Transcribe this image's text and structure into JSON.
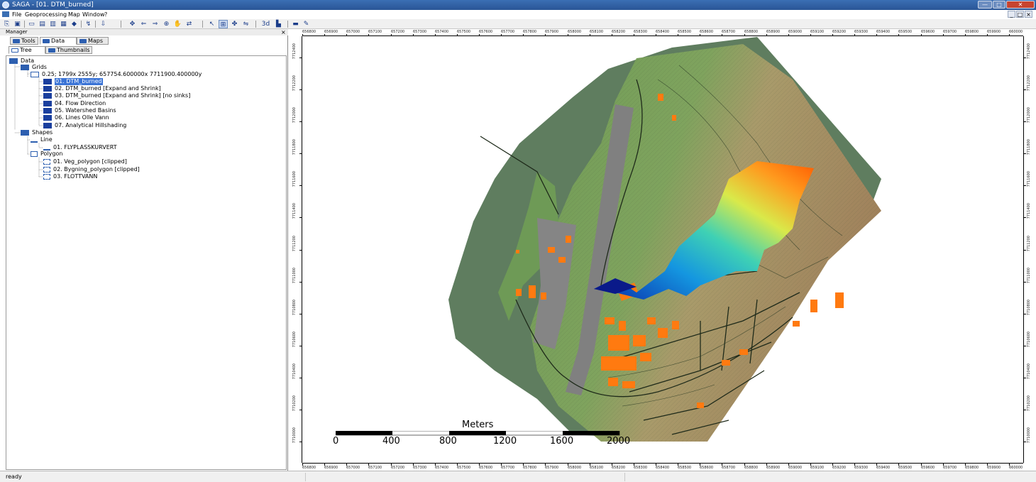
{
  "window": {
    "title": "SAGA - [01. DTM_burned]",
    "buttons": {
      "minimize": "—",
      "maximize": "□",
      "close": "✕"
    }
  },
  "menubar": {
    "items": [
      "File",
      "Geoprocessing",
      "Map",
      "Window",
      "?"
    ],
    "mdi_buttons": [
      "_",
      "□",
      "×"
    ]
  },
  "manager": {
    "title": "Manager",
    "close": "×",
    "tabs": [
      "Tools",
      "Data",
      "Maps"
    ],
    "active_tab": "Data",
    "subtabs": [
      "Tree",
      "Thumbnails"
    ],
    "active_subtab": "Tree"
  },
  "tree": {
    "root": "Data",
    "grids_label": "Grids",
    "grid_system": "0.25; 1799x 2555y; 657754.600000x 7711900.400000y",
    "grids": [
      "01. DTM_burned",
      "02. DTM_burned [Expand and Shrink]",
      "03. DTM_burned [Expand and Shrink] [no sinks]",
      "04. Flow Direction",
      "05. Watershed Basins",
      "06. Lines Olle Vann",
      "07. Analytical Hillshading"
    ],
    "selected_grid": "01. DTM_burned",
    "shapes_label": "Shapes",
    "line_label": "Line",
    "lines": [
      "01. FLYPLASSKURVERT"
    ],
    "polygon_label": "Polygon",
    "polygons": [
      "01. Veg_polygon [clipped]",
      "02. Bygning_polygon [clipped]",
      "03. FLOTTVANN"
    ]
  },
  "map": {
    "ruler_top": [
      "656800",
      "656900",
      "657000",
      "657100",
      "657200",
      "657300",
      "657400",
      "657500",
      "657600",
      "657700",
      "657800",
      "657900",
      "658000",
      "658100",
      "658200",
      "658300",
      "658400",
      "658500",
      "658600",
      "658700",
      "658800",
      "658900",
      "659000",
      "659100",
      "659200",
      "659300",
      "659400",
      "659500",
      "659600",
      "659700",
      "659800",
      "659900",
      "660000"
    ],
    "ruler_bottom": [
      "656800",
      "656900",
      "657000",
      "657100",
      "657200",
      "657300",
      "657400",
      "657500",
      "657600",
      "657700",
      "657800",
      "657900",
      "658000",
      "658100",
      "658200",
      "658300",
      "658400",
      "658500",
      "658600",
      "658700",
      "658800",
      "658900",
      "659000",
      "659100",
      "659200",
      "659300",
      "659400",
      "659500",
      "659600",
      "659700",
      "659800",
      "659900",
      "660000"
    ],
    "ruler_left": [
      "7712400",
      "7712200",
      "7712000",
      "7711800",
      "7711600",
      "7711400",
      "7711200",
      "7711000",
      "7710800",
      "7710600",
      "7710400",
      "7710200",
      "7710000"
    ],
    "ruler_right": [
      "7712400",
      "7712200",
      "7712000",
      "7711800",
      "7711600",
      "7711400",
      "7711200",
      "7711000",
      "7710800",
      "7710600",
      "7710400",
      "7710200",
      "7710000"
    ],
    "scalebar": {
      "title": "Meters",
      "labels": [
        "0",
        "400",
        "800",
        "1200",
        "1600",
        "2000"
      ]
    },
    "colors": {
      "sea_green": "#5f7d5f",
      "terrain_green": "#6e9a56",
      "terrain_brown": "#a89067",
      "runway": "#808080",
      "buildings": "#ff7a10",
      "basin_low": "#0a2aa8",
      "basin_mid": "#19b9e0",
      "basin_high": "#ff6a00"
    }
  },
  "status": {
    "text": "ready"
  }
}
